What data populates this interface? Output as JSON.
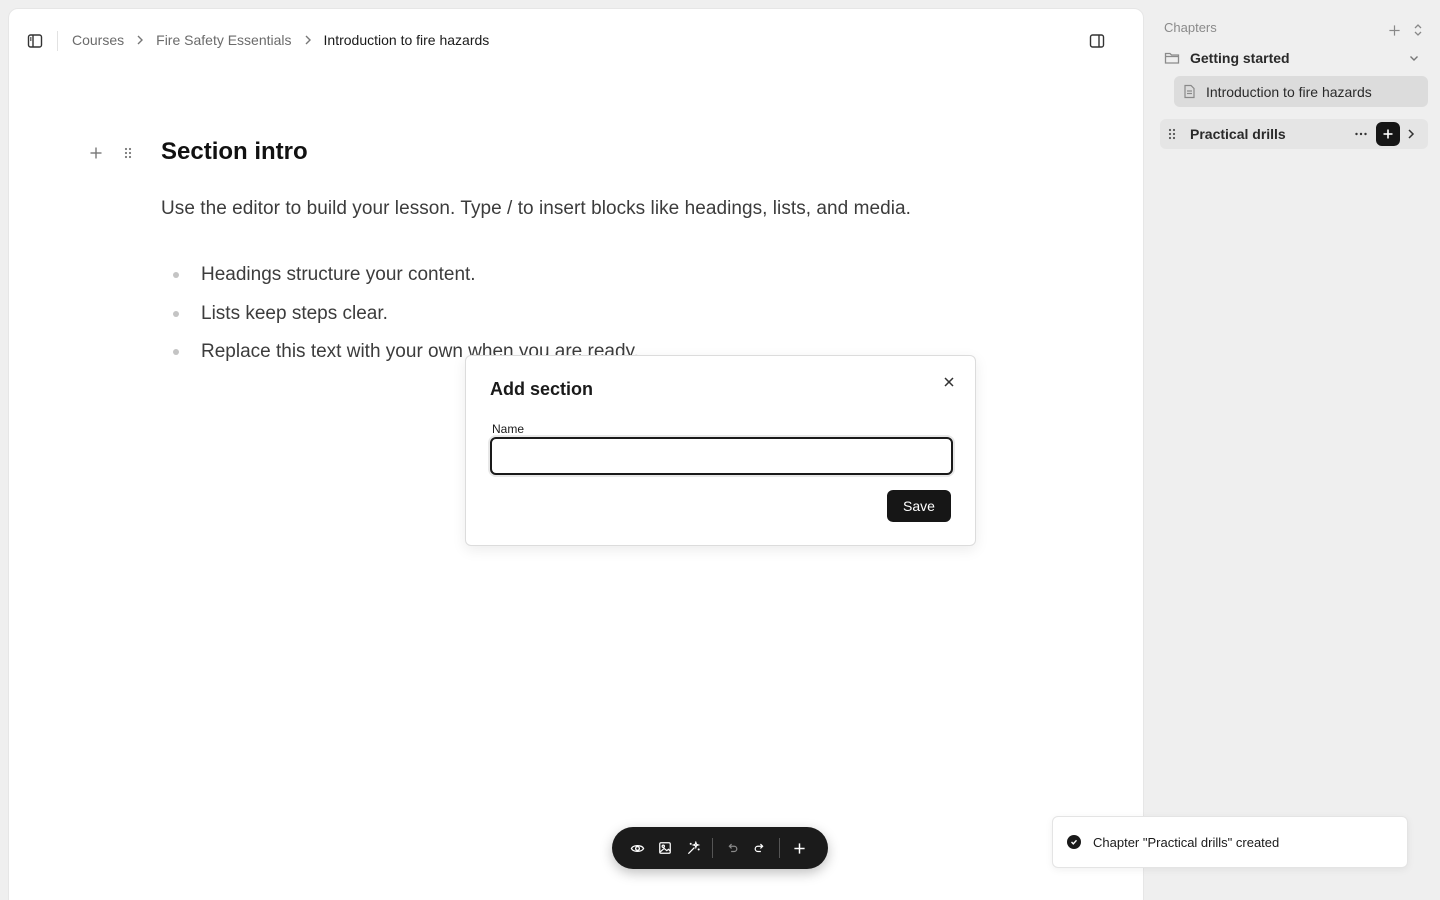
{
  "breadcrumb": {
    "items": [
      "Courses",
      "Fire Safety Essentials",
      "Introduction to fire hazards"
    ]
  },
  "editor": {
    "heading": "Section intro",
    "lead": "Use the editor to build your lesson. Type / to insert blocks like headings, lists, and media.",
    "bullets": [
      "Headings structure your content.",
      "Lists keep steps clear.",
      "Replace this text with your own when you are ready."
    ]
  },
  "dialog": {
    "title": "Add section",
    "name_label": "Name",
    "name_value": "",
    "save_label": "Save"
  },
  "toolbar": {
    "icons": [
      "eye-icon",
      "image-icon",
      "sparkles-icon",
      "undo-icon",
      "redo-icon",
      "plus-icon"
    ]
  },
  "sidebar": {
    "header": "Chapters",
    "groups": [
      {
        "label": "Getting started",
        "items": [
          {
            "label": "Introduction to fire hazards"
          }
        ]
      },
      {
        "label": "Practical drills"
      }
    ]
  },
  "toast": {
    "message": "Chapter \"Practical drills\" created"
  },
  "colors": {
    "accent_dark": "#161616",
    "page_bg": "#efefef",
    "selected_item_bg": "#dcdcdc"
  }
}
